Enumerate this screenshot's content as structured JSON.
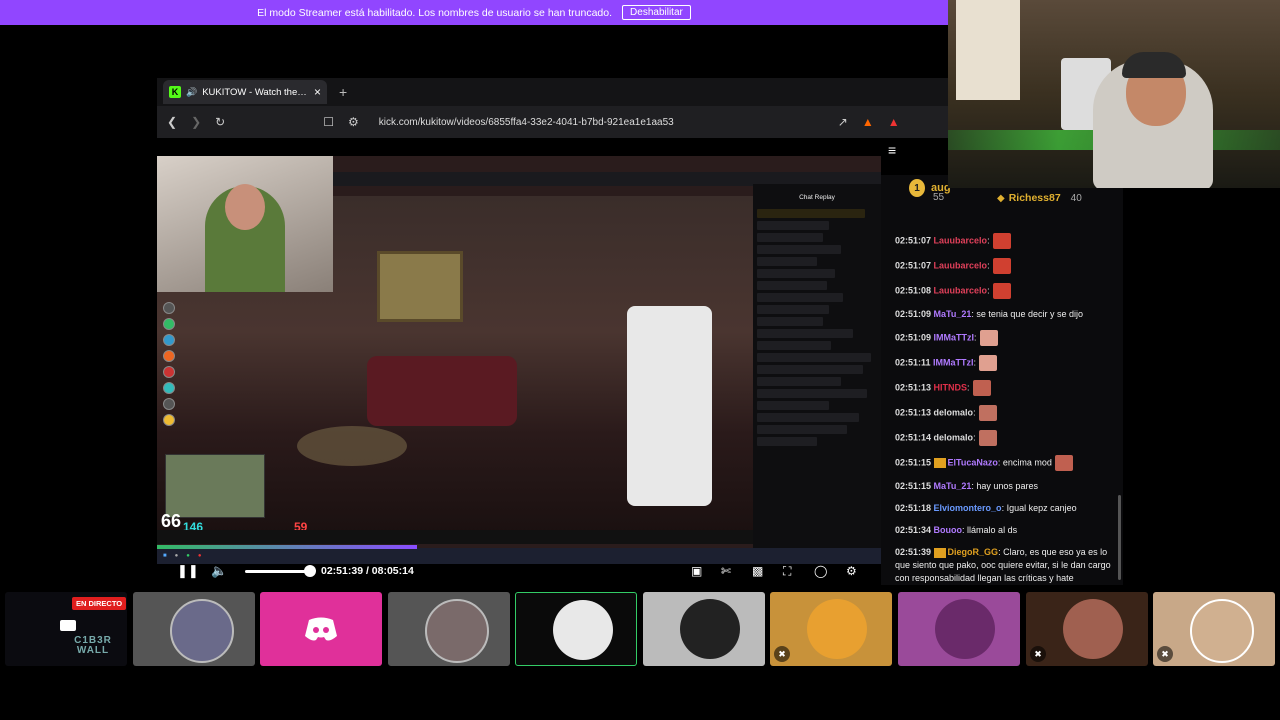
{
  "streamer_bar": {
    "message": "El modo Streamer está habilitado. Los nombres de usuario se han truncado.",
    "disable_label": "Deshabilitar"
  },
  "browser": {
    "tab_title": "KUKITOW - Watch the VOD o",
    "tab_close": "×",
    "new_tab": "+",
    "url": "kick.com/kukitow/videos/6855ffa4-33e2-4041-b7bd-921ea1e1aa53"
  },
  "game": {
    "hud_number": "66",
    "health": "146",
    "armor": "59"
  },
  "inner_chat": {
    "title": "Chat Replay"
  },
  "player": {
    "time": "02:51:39 / 08:05:14",
    "progress_fraction": 0.354
  },
  "leaderboard": {
    "first_name": "aug",
    "first_rank": "1",
    "first_points": "55",
    "second_name": "Richess87",
    "second_points": "40"
  },
  "chat": [
    {
      "ts": "02:51:07",
      "user": "Lauubarcelo",
      "text": ":",
      "color": "#e0405a",
      "emote": "#d04030"
    },
    {
      "ts": "02:51:07",
      "user": "Lauubarcelo",
      "text": ":",
      "color": "#e0405a",
      "emote": "#d04030"
    },
    {
      "ts": "02:51:08",
      "user": "Lauubarcelo",
      "text": ":",
      "color": "#e0405a",
      "emote": "#d04030"
    },
    {
      "ts": "02:51:09",
      "user": "MaTu_21",
      "text": ": se tenia que decir y se dijo",
      "color": "#b07aff",
      "emote": ""
    },
    {
      "ts": "02:51:09",
      "user": "IMMaTTzI",
      "text": ":",
      "color": "#b07aff",
      "emote": "#e0a090"
    },
    {
      "ts": "02:51:11",
      "user": "IMMaTTzI",
      "text": ":",
      "color": "#b07aff",
      "emote": "#e0a090"
    },
    {
      "ts": "02:51:13",
      "user": "HITNDS",
      "text": ":",
      "color": "#e0304a",
      "emote": "#c06050"
    },
    {
      "ts": "02:51:13",
      "user": "delomalo",
      "text": ":",
      "color": "#dddddd",
      "emote": "#c07060"
    },
    {
      "ts": "02:51:14",
      "user": "delomalo",
      "text": ":",
      "color": "#dddddd",
      "emote": "#c07060"
    },
    {
      "ts": "02:51:15",
      "user": "ElTucaNazo",
      "text": ": encima mod",
      "color": "#b07aff",
      "emote": "#c06050",
      "badge": true
    },
    {
      "ts": "02:51:15",
      "user": "MaTu_21",
      "text": ": hay unos pares",
      "color": "#b07aff",
      "emote": ""
    },
    {
      "ts": "02:51:18",
      "user": "Elviomontero_o",
      "text": ": Igual kepz canjeo",
      "color": "#6a9aff",
      "emote": ""
    },
    {
      "ts": "02:51:34",
      "user": "Bouoo",
      "text": ": llámalo al ds",
      "color": "#b07aff",
      "emote": ""
    },
    {
      "ts": "02:51:39",
      "user": "DiegoR_GG",
      "text": ": Claro, es que eso ya es lo que siento que pako, ooc quiere evitar, si le dan cargo con responsabilidad llegan las críticas y hate",
      "color": "#e0a020",
      "emote": "",
      "badge": true
    }
  ],
  "bottom": {
    "live_label": "EN DIRECTO",
    "cyberwall_label": "C1B3R WALL"
  },
  "colors": {
    "accent": "#9146ff",
    "kick": "#53fc18",
    "discord": "#e0309a"
  }
}
